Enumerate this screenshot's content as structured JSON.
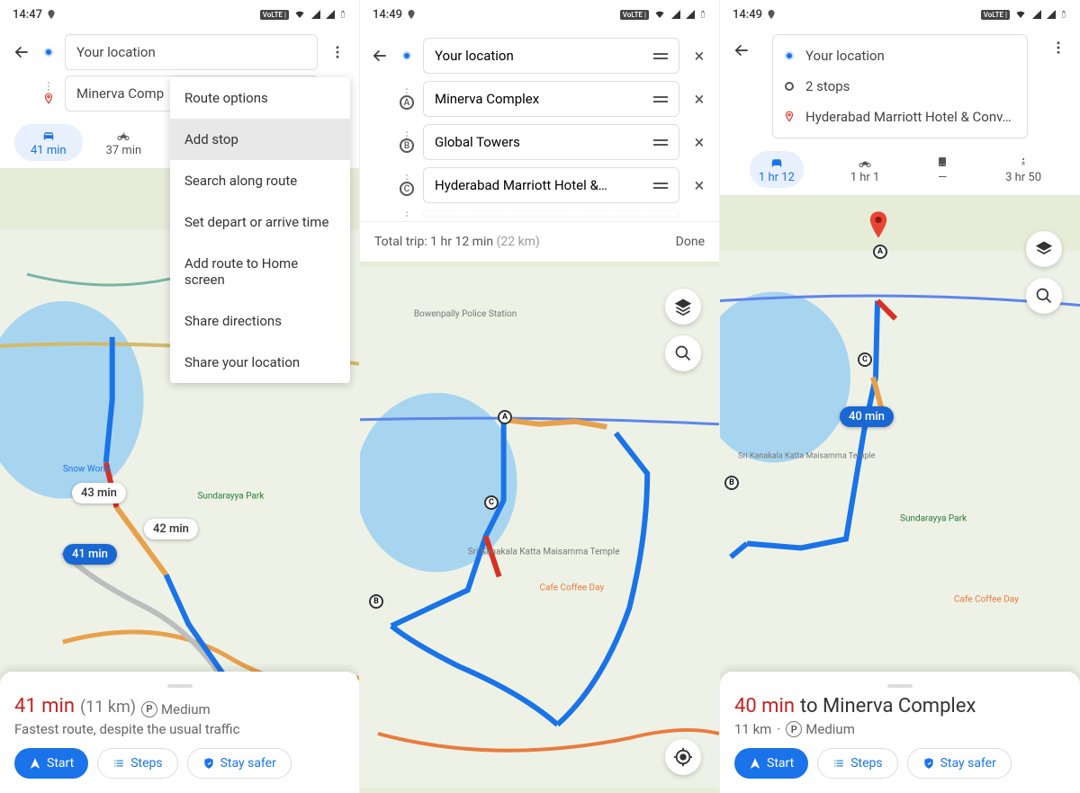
{
  "screens": [
    {
      "statusbar": {
        "time": "14:47"
      },
      "inputs": {
        "from": "Your location",
        "to": "Minerva Comp"
      },
      "transport": {
        "car": "41 min",
        "moto": "37 min"
      },
      "menu": {
        "items": [
          "Route options",
          "Add stop",
          "Search along route",
          "Set depart or arrive time",
          "Add route to Home screen",
          "Share directions",
          "Share your location"
        ],
        "selected_index": 1
      },
      "map_badges": [
        "43 min",
        "42 min",
        "41 min"
      ],
      "sheet": {
        "duration": "41 min",
        "distance": "(11 km)",
        "parking": "Medium",
        "subtitle": "Fastest route, despite the usual traffic",
        "start": "Start",
        "steps": "Steps",
        "stay_safer": "Stay safer"
      }
    },
    {
      "statusbar": {
        "time": "14:49"
      },
      "inputs": {
        "from": "Your location",
        "stops": [
          "Minerva Complex",
          "Global Towers",
          "Hyderabad Marriott Hotel &…"
        ]
      },
      "tripbar": {
        "text": "Total trip: 1 hr 12 min",
        "dist": "(22 km)",
        "done": "Done"
      }
    },
    {
      "statusbar": {
        "time": "14:49"
      },
      "summary": {
        "from": "Your location",
        "stops": "2 stops",
        "dest": "Hyderabad Marriott Hotel & Conv…"
      },
      "transport": {
        "car": "1 hr 12",
        "moto": "1 hr 1",
        "transit": "—",
        "walk": "3 hr 50"
      },
      "map_badges": [
        "40 min"
      ],
      "sheet": {
        "duration": "40 min",
        "dest": "to Minerva Complex",
        "distance": "11 km",
        "parking": "Medium",
        "start": "Start",
        "steps": "Steps",
        "stay_safer": "Stay safer"
      }
    }
  ],
  "icons": {
    "volte": "VoLTE |"
  }
}
